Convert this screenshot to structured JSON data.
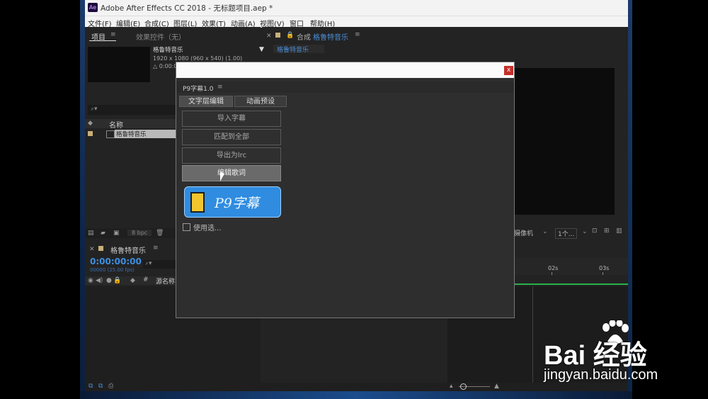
{
  "window": {
    "title": "Adobe After Effects CC 2018 - 无标题项目.aep *",
    "app_badge": "Ae"
  },
  "menu": [
    "文件(F)",
    "编辑(E)",
    "合成(C)",
    "图层(L)",
    "效果(T)",
    "动画(A)",
    "视图(V)",
    "窗口",
    "帮助(H)"
  ],
  "project_panel": {
    "tab_project": "项目",
    "tab_effects": "效果控件（无）",
    "item_name": "格鲁特音乐",
    "item_info": [
      "1920 x 1080  (960 x 540) (1.00)",
      "△ 0:00:0"
    ],
    "column_name": "名称",
    "row_name": "格鲁特音乐",
    "bpc": "8 bpc"
  },
  "comp_panel": {
    "tab_prefix": "合成",
    "tab_name": "格鲁特音乐",
    "sub_tab": "格鲁特音乐",
    "camera": "摄像机",
    "views": "1个..."
  },
  "timeline": {
    "tab_name": "格鲁特音乐",
    "timecode": "0:00:00:00",
    "fps": "00000 (25.00 fps)",
    "col_hash": "#",
    "col_source": "源名称",
    "ruler_labels": [
      "02s",
      "03s"
    ]
  },
  "dialog": {
    "panel_title": "P9字幕1.0",
    "tab_text_edit": "文字层编辑",
    "tab_anim_preset": "动画预设",
    "buttons": [
      "导入字幕",
      "匹配到全部",
      "导出为lrc",
      "编辑歌词"
    ],
    "logo_text": "P9字幕",
    "checkbox_label": "使用选...",
    "close": "x"
  },
  "watermark": {
    "brand": "Bai  经验",
    "url": "jingyan.baidu.com"
  },
  "colors": {
    "accent_blue": "#3d8fe0",
    "dialog_close": "#c4302b",
    "timeline_green": "#27b24a",
    "logo_blue": "#2f8ce0"
  }
}
